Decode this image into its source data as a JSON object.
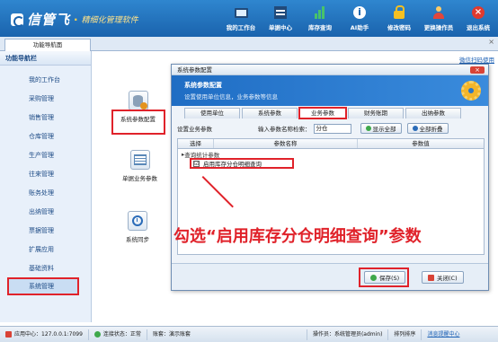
{
  "header": {
    "logo_text": "信管飞",
    "logo_dot": "·",
    "logo_subtitle": "精细化管理软件",
    "toolbar": [
      {
        "label": "我的工作台",
        "icon": "monitor-icon"
      },
      {
        "label": "单据中心",
        "icon": "document-grid-icon"
      },
      {
        "label": "库存查询",
        "icon": "bar-chart-icon"
      },
      {
        "label": "AI助手",
        "icon": "info-icon"
      },
      {
        "label": "修改密码",
        "icon": "lock-icon"
      },
      {
        "label": "更换操作员",
        "icon": "user-icon"
      },
      {
        "label": "退出系统",
        "icon": "exit-icon"
      }
    ]
  },
  "tabs": {
    "main_tab": "功能导航面",
    "close": "×"
  },
  "sidebar": {
    "title": "功能导航栏",
    "items": [
      {
        "label": "我的工作台"
      },
      {
        "label": "采购管理"
      },
      {
        "label": "销售管理"
      },
      {
        "label": "仓库管理"
      },
      {
        "label": "生产管理"
      },
      {
        "label": "往来管理"
      },
      {
        "label": "账务处理"
      },
      {
        "label": "出纳管理"
      },
      {
        "label": "票据管理"
      },
      {
        "label": "扩展应用"
      },
      {
        "label": "基础资料"
      },
      {
        "label": "系统管理"
      }
    ]
  },
  "panel": {
    "hint_link": "微信扫码使用",
    "apps": [
      {
        "label": "系统参数配置",
        "icon": "database-settings-icon"
      },
      {
        "label": "单据业务参数",
        "icon": "form-icon"
      },
      {
        "label": "系统同步",
        "icon": "clock-icon"
      }
    ]
  },
  "dialog": {
    "title": "系统参数配置",
    "close": "×",
    "banner_title": "系统参数配置",
    "banner_subtitle": "设置使用单位信息，业务参数等信息",
    "tabs": [
      "使用单位",
      "系统参数",
      "业务参数",
      "财务账期",
      "出纳参数"
    ],
    "active_tab": "业务参数",
    "filter_label": "设置业务参数",
    "search_label": "输入参数名称检索：",
    "search_value": "分仓",
    "show_all_button": "显示全部",
    "collapse_all_button": "全部折叠",
    "columns": [
      "选择",
      "参数名称",
      "参数值"
    ],
    "group_label": "查询统计参数",
    "param_label": "启用库存分仓明细查询",
    "param_checked": "☑",
    "save_button": "保存(S)",
    "close_button": "关闭(C)"
  },
  "annotation": "勾选“启用库存分仓明细查询”参数",
  "statusbar": {
    "server": "应用中心：127.0.0.1:7099",
    "connection": "连接状态：正常",
    "account": "账套：演示账套",
    "operator": "操作员：系统管理员(admin)",
    "rank": "排列排序",
    "message": "消息提醒中心"
  }
}
